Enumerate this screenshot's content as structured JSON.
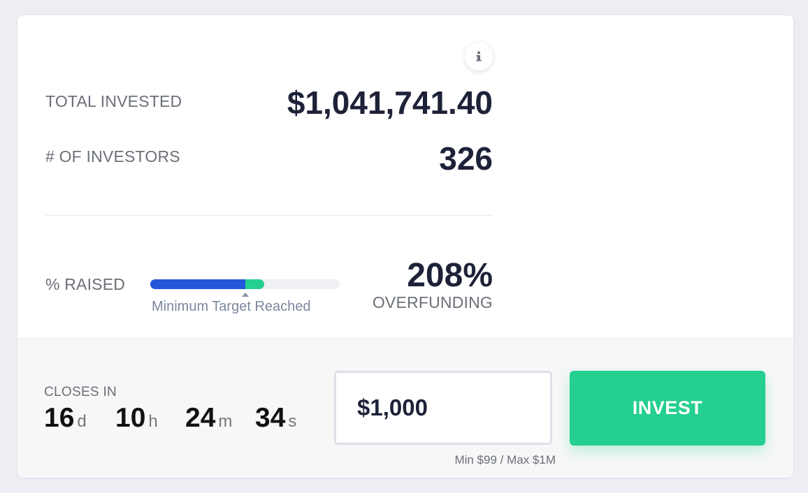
{
  "stats": {
    "total_invested_label": "TOTAL INVESTED",
    "total_invested_value": "$1,041,741.40",
    "investors_label": "# OF INVESTORS",
    "investors_value": "326",
    "raised_label": "% RAISED",
    "raised_percent": "208%",
    "overfunding_label": "OVERFUNDING",
    "target_text": "Minimum Target Reached",
    "progress": {
      "minimum_target_fraction": 0.5,
      "overfunding_fraction": 0.1
    }
  },
  "icons": {
    "info": "info-icon"
  },
  "colors": {
    "progress_primary": "#2356d9",
    "progress_overfunding": "#24cf90",
    "invest_button": "#24cf90",
    "value_text": "#1e2238"
  },
  "footer": {
    "closes_label": "CLOSES IN",
    "countdown": {
      "days": "16",
      "days_unit": "d",
      "hours": "10",
      "hours_unit": "h",
      "minutes": "24",
      "minutes_unit": "m",
      "seconds": "34",
      "seconds_unit": "s"
    },
    "amount_value": "$1,000",
    "limits": "Min $99 / Max $1M",
    "invest_label": "INVEST"
  }
}
